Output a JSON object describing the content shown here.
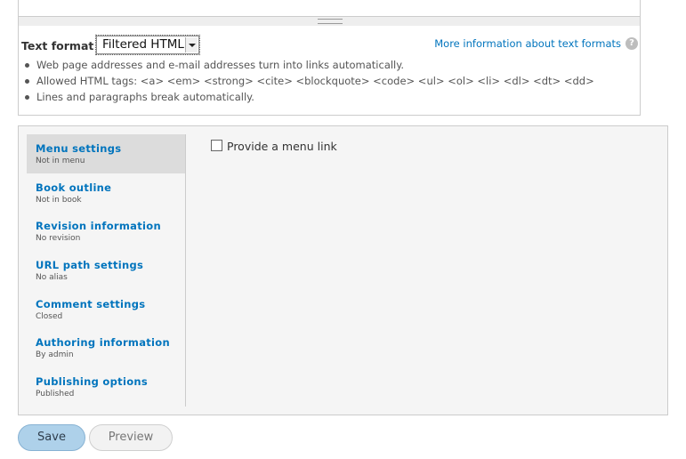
{
  "editor": {
    "text_format_label": "Text format",
    "format_select": {
      "selected": "Filtered HTML"
    },
    "more_info_link": "More information about text formats",
    "help_icon_glyph": "?",
    "tips": [
      "Web page addresses and e-mail addresses turn into links automatically.",
      "Allowed HTML tags: <a> <em> <strong> <cite> <blockquote> <code> <ul> <ol> <li> <dl> <dt> <dd>",
      "Lines and paragraphs break automatically."
    ]
  },
  "vertical_tabs": {
    "items": [
      {
        "title": "Menu settings",
        "summary": "Not in menu",
        "selected": true
      },
      {
        "title": "Book outline",
        "summary": "Not in book",
        "selected": false
      },
      {
        "title": "Revision information",
        "summary": "No revision",
        "selected": false
      },
      {
        "title": "URL path settings",
        "summary": "No alias",
        "selected": false
      },
      {
        "title": "Comment settings",
        "summary": "Closed",
        "selected": false
      },
      {
        "title": "Authoring information",
        "summary": "By admin",
        "selected": false
      },
      {
        "title": "Publishing options",
        "summary": "Published",
        "selected": false
      }
    ],
    "pane": {
      "checkbox_label": "Provide a menu link",
      "checked": false
    }
  },
  "actions": {
    "save_label": "Save",
    "preview_label": "Preview"
  },
  "colors": {
    "link": "#0074bd",
    "save_button": "#aed1ea",
    "selected_tab": "#dcdcdc"
  }
}
